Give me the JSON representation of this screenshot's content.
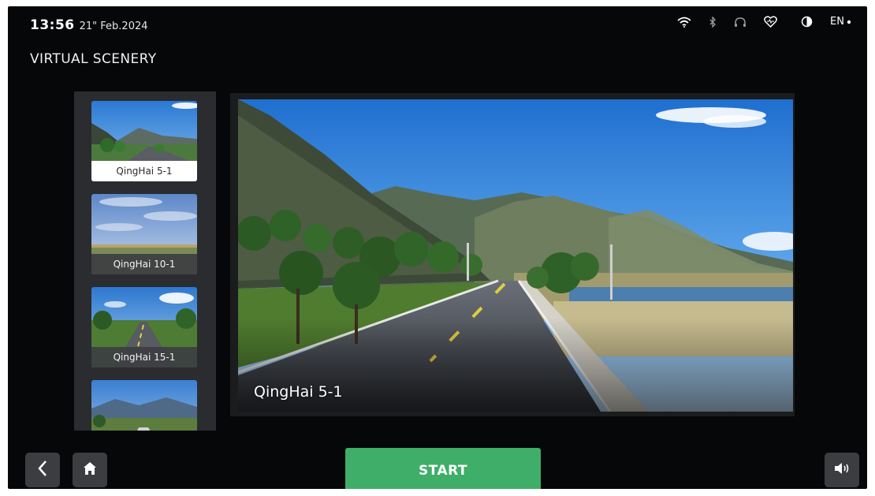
{
  "status": {
    "time": "13:56",
    "date": "21\" Feb.2024",
    "language": "EN",
    "icons": [
      "wifi-icon",
      "bluetooth-icon",
      "headphones-icon",
      "heart-rate-icon",
      "brightness-icon"
    ]
  },
  "page": {
    "title": "VIRTUAL SCENERY"
  },
  "scenery_list": [
    {
      "label": "QingHai 5-1",
      "selected": true
    },
    {
      "label": "QingHai 10-1",
      "selected": false
    },
    {
      "label": "QingHai 15-1",
      "selected": false
    },
    {
      "label": "",
      "selected": false
    }
  ],
  "preview": {
    "label": "QingHai 5-1"
  },
  "bottom_bar": {
    "start_label": "START",
    "icons": [
      "back-icon",
      "home-icon",
      "volume-icon"
    ]
  },
  "colors": {
    "accent": "#3fae68",
    "background": "#060708",
    "panel": "#2a2c2f"
  }
}
